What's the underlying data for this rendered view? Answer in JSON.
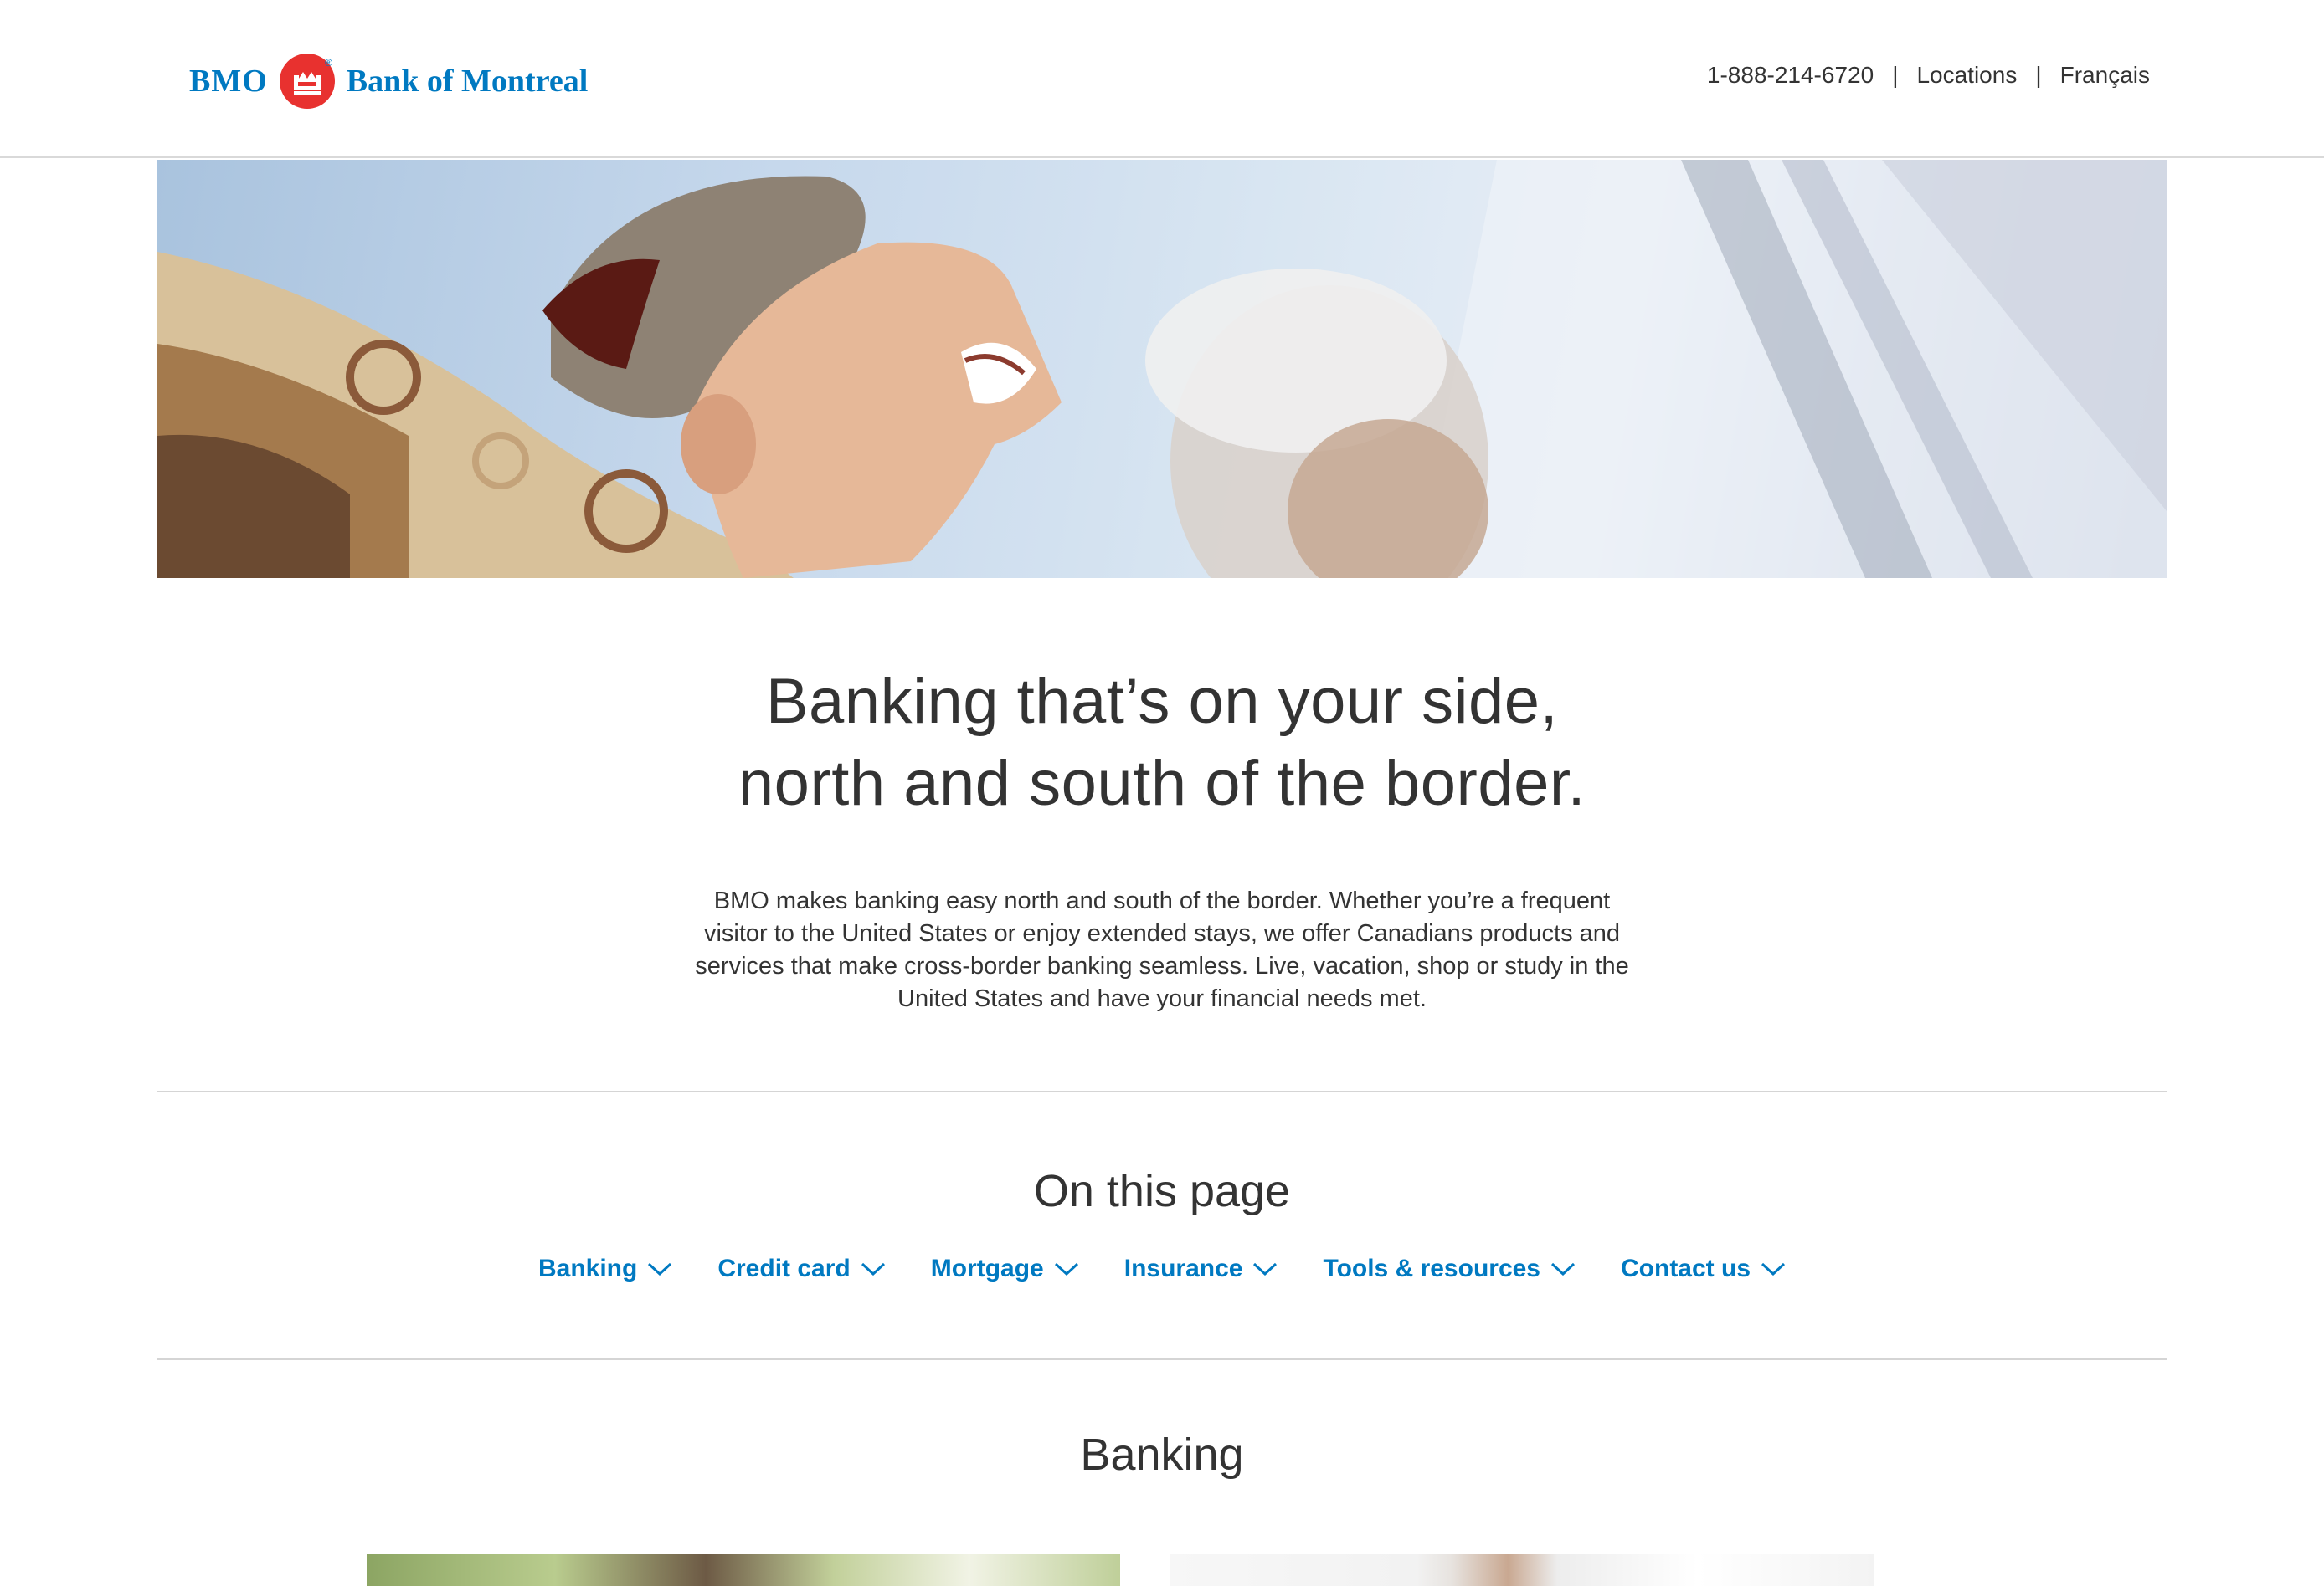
{
  "header": {
    "logo": {
      "bmo": "BMO",
      "bank_name": "Bank of Montreal",
      "registered": "®",
      "brand_color": "#0079c1",
      "roundel_color": "#e8312f"
    },
    "utility_nav": {
      "phone": "1-888-214-6720",
      "separator": "|",
      "locations": "Locations",
      "language": "Français"
    }
  },
  "hero": {
    "image_icon": "hero-photo"
  },
  "intro": {
    "headline_line1": "Banking that’s on your side,",
    "headline_line2": "north and south of the border.",
    "body": "BMO makes banking easy north and south of the border. Whether you’re a frequent visitor to the United States or enjoy extended stays, we offer Canadians products and services that make cross-border banking seamless. Live, vacation, shop or study in the United States and have your financial needs met."
  },
  "on_this_page": {
    "title": "On this page",
    "links": [
      {
        "label": "Banking"
      },
      {
        "label": "Credit card"
      },
      {
        "label": "Mortgage"
      },
      {
        "label": "Insurance"
      },
      {
        "label": "Tools & resources"
      },
      {
        "label": "Contact us"
      }
    ],
    "link_color": "#0079c1"
  },
  "banking_section": {
    "title": "Banking"
  }
}
